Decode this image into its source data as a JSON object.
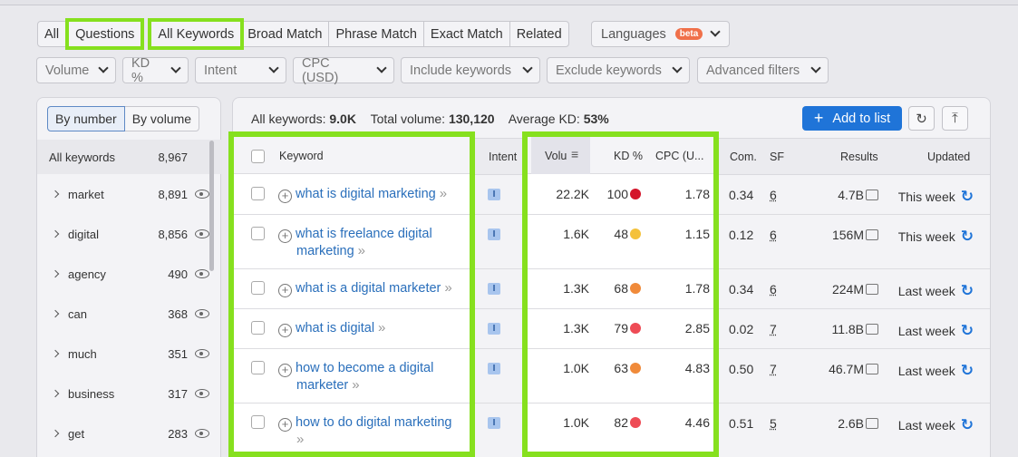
{
  "tabs": [
    "All",
    "Questions",
    "All Keywords",
    "Broad Match",
    "Phrase Match",
    "Exact Match",
    "Related"
  ],
  "languages": {
    "label": "Languages",
    "badge": "beta"
  },
  "filters": [
    "Volume",
    "KD %",
    "Intent",
    "CPC (USD)",
    "Include keywords",
    "Exclude keywords",
    "Advanced filters"
  ],
  "left_panel": {
    "seg": [
      "By number",
      "By volume"
    ],
    "header": {
      "label": "All keywords",
      "count": "8,967"
    },
    "groups": [
      {
        "name": "market",
        "count": "8,891"
      },
      {
        "name": "digital",
        "count": "8,856"
      },
      {
        "name": "agency",
        "count": "490"
      },
      {
        "name": "can",
        "count": "368"
      },
      {
        "name": "much",
        "count": "351"
      },
      {
        "name": "business",
        "count": "317"
      },
      {
        "name": "get",
        "count": "283"
      }
    ]
  },
  "stats": {
    "all_label": "All keywords:",
    "all_value": "9.0K",
    "vol_label": "Total volume:",
    "vol_value": "130,120",
    "kd_label": "Average KD:",
    "kd_value": "53%"
  },
  "add_button": "Add to list",
  "columns": {
    "keyword": "Keyword",
    "intent": "Intent",
    "volume": "Volu",
    "kd": "KD %",
    "cpc": "CPC (U...",
    "com": "Com.",
    "sf": "SF",
    "results": "Results",
    "updated": "Updated"
  },
  "rows": [
    {
      "kw1": "what is digital marketing",
      "kw2": "",
      "intent": "I",
      "volume": "22.2K",
      "kd": "100",
      "kd_color": "#d4142a",
      "cpc": "1.78",
      "com": "0.34",
      "sf": "6",
      "results": "4.7B",
      "updated": "This week"
    },
    {
      "kw1": "what is freelance digital",
      "kw2": "marketing",
      "intent": "I",
      "volume": "1.6K",
      "kd": "48",
      "kd_color": "#f4c13a",
      "cpc": "1.15",
      "com": "0.12",
      "sf": "6",
      "results": "156M",
      "updated": "This week"
    },
    {
      "kw1": "what is a digital marketer",
      "kw2": "",
      "intent": "I",
      "volume": "1.3K",
      "kd": "68",
      "kd_color": "#f08a3a",
      "cpc": "1.78",
      "com": "0.34",
      "sf": "6",
      "results": "224M",
      "updated": "Last week"
    },
    {
      "kw1": "what is digital",
      "kw2": "",
      "intent": "I",
      "volume": "1.3K",
      "kd": "79",
      "kd_color": "#ee4b55",
      "cpc": "2.85",
      "com": "0.02",
      "sf": "7",
      "results": "11.8B",
      "updated": "Last week"
    },
    {
      "kw1": "how to become a digital",
      "kw2": "marketer",
      "intent": "I",
      "volume": "1.0K",
      "kd": "63",
      "kd_color": "#f08a3a",
      "cpc": "4.83",
      "com": "0.50",
      "sf": "7",
      "results": "46.7M",
      "updated": "Last week"
    },
    {
      "kw1": "how to do digital marketing",
      "kw2": "",
      "intent": "I",
      "volume": "1.0K",
      "kd": "82",
      "kd_color": "#ee4b55",
      "cpc": "4.46",
      "com": "0.51",
      "sf": "5",
      "results": "2.6B",
      "updated": "Last week"
    }
  ]
}
